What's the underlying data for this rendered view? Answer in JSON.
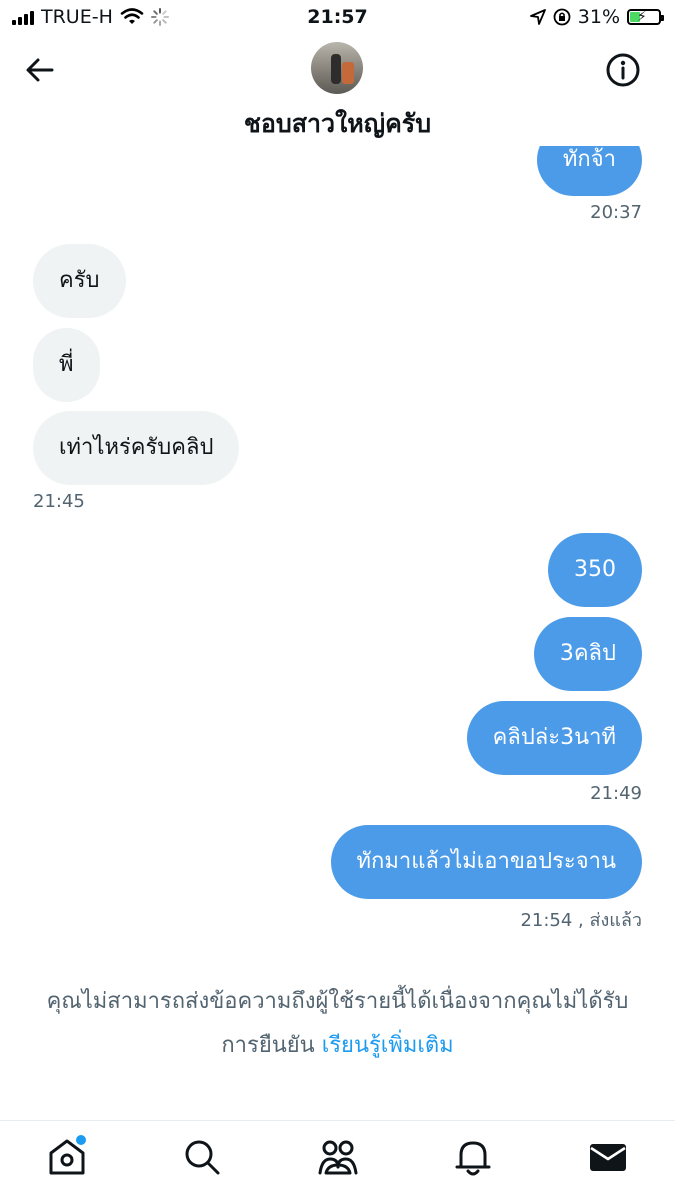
{
  "status_bar": {
    "carrier": "TRUE-H",
    "time": "21:57",
    "battery": "31%"
  },
  "header": {
    "name": "ชอบสาวใหญ่ครับ"
  },
  "messages": [
    {
      "dir": "out",
      "text": "ทักจ้า"
    },
    {
      "dir": "out_ts",
      "text": "20:37"
    },
    {
      "dir": "in",
      "text": "ครับ"
    },
    {
      "dir": "in",
      "text": "พี่"
    },
    {
      "dir": "in",
      "text": "เท่าไหร่ครับคลิป"
    },
    {
      "dir": "in_ts",
      "text": "21:45"
    },
    {
      "dir": "out",
      "text": "350"
    },
    {
      "dir": "out",
      "text": "3คลิป"
    },
    {
      "dir": "out",
      "text": "คลิปล่ะ3นาที"
    },
    {
      "dir": "out_ts",
      "text": "21:49"
    },
    {
      "dir": "out",
      "text": "ทักมาแล้วไม่เอาขอประจาน"
    },
    {
      "dir": "out_ts",
      "text": "21:54 , ส่งแล้ว"
    }
  ],
  "notice": {
    "line1": "คุณไม่สามารถส่งข้อความถึงผู้ใช้รายนี้ได้เนื่องจากคุณไม่ได้รับ",
    "line2_prefix": "การยืนยัน",
    "link": "เรียนรู้เพิ่มเติม"
  },
  "tabs": [
    {
      "icon": "home-icon",
      "badge": true
    },
    {
      "icon": "search-icon"
    },
    {
      "icon": "communities-icon"
    },
    {
      "icon": "bell-icon"
    },
    {
      "icon": "mail-icon",
      "active": true
    }
  ],
  "colors": {
    "outgoing_bubble": "#4c9be8",
    "incoming_bubble": "#eff3f4",
    "link": "#1d9bf0",
    "muted_text": "#536471"
  }
}
